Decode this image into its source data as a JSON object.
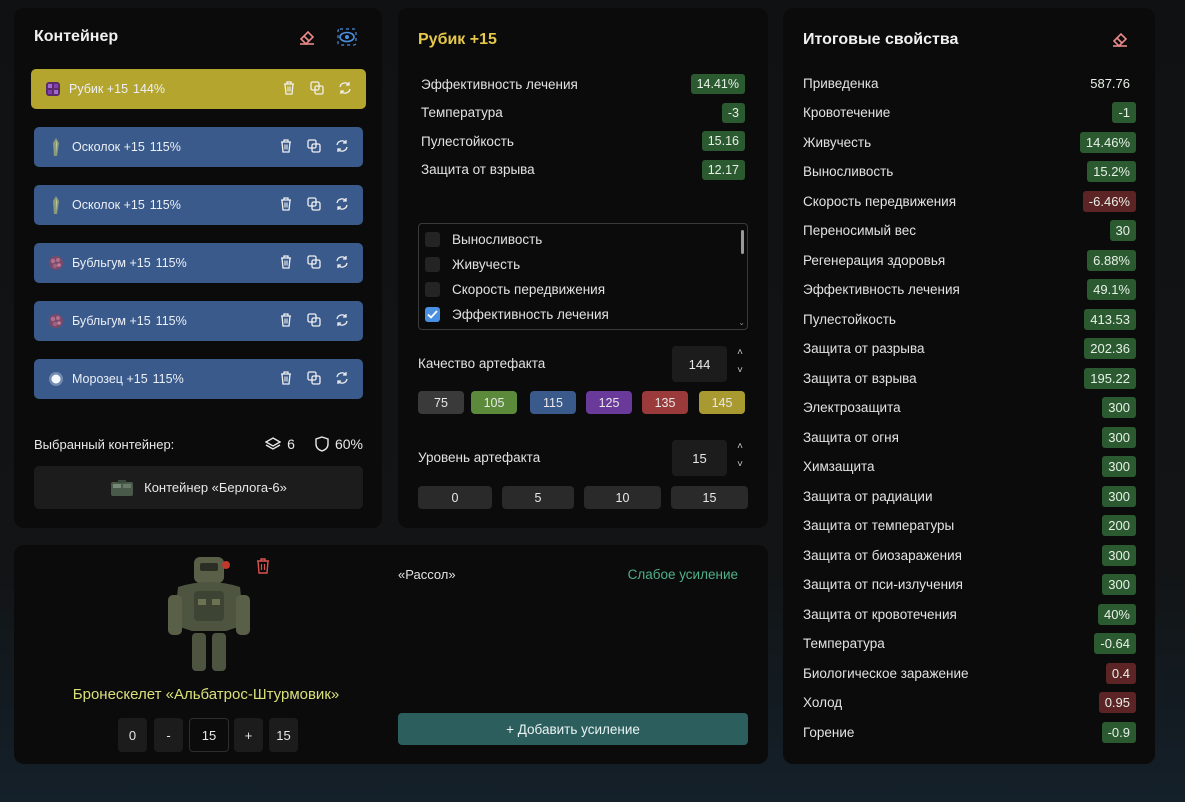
{
  "container": {
    "title": "Контейнер",
    "slots": [
      {
        "name": "Рубик +15",
        "pct": "144%",
        "active": true,
        "icon": "rubik-artifact-icon"
      },
      {
        "name": "Осколок +15",
        "pct": "115%",
        "active": false,
        "icon": "shard-artifact-icon"
      },
      {
        "name": "Осколок +15",
        "pct": "115%",
        "active": false,
        "icon": "shard-artifact-icon"
      },
      {
        "name": "Бубльгум +15",
        "pct": "115%",
        "active": false,
        "icon": "bubblegum-artifact-icon"
      },
      {
        "name": "Бубльгум +15",
        "pct": "115%",
        "active": false,
        "icon": "bubblegum-artifact-icon"
      },
      {
        "name": "Морозец +15",
        "pct": "115%",
        "active": false,
        "icon": "frost-artifact-icon"
      }
    ],
    "selected_label": "Выбранный контейнер:",
    "capacity": "6",
    "protection": "60%",
    "container_name": "Контейнер «Берлога-6»"
  },
  "artifact": {
    "title": "Рубик +15",
    "stats": [
      {
        "label": "Эффективность лечения",
        "value": "14.41%",
        "tone": "green"
      },
      {
        "label": "Температура",
        "value": "-3",
        "tone": "green"
      },
      {
        "label": "Пулестойкость",
        "value": "15.16",
        "tone": "green"
      },
      {
        "label": "Защита от взрыва",
        "value": "12.17",
        "tone": "green"
      }
    ],
    "options": [
      {
        "label": "Выносливость",
        "checked": false
      },
      {
        "label": "Живучесть",
        "checked": false
      },
      {
        "label": "Скорость передвижения",
        "checked": false
      },
      {
        "label": "Эффективность лечения",
        "checked": true
      }
    ],
    "quality_label": "Качество артефакта",
    "quality_value": "144",
    "quality_presets": [
      {
        "label": "75",
        "color": "#3a3a3a"
      },
      {
        "label": "105",
        "color": "#5a8a3a"
      },
      {
        "label": "115",
        "color": "#3a5a8c"
      },
      {
        "label": "125",
        "color": "#6a3a9a"
      },
      {
        "label": "135",
        "color": "#9a3a3a"
      },
      {
        "label": "145",
        "color": "#a89a30"
      }
    ],
    "level_label": "Уровень артефакта",
    "level_value": "15",
    "level_presets": [
      "0",
      "5",
      "10",
      "15"
    ]
  },
  "totals": {
    "title": "Итоговые свойства",
    "rows": [
      {
        "label": "Приведенка",
        "value": "587.76",
        "tone": "plain"
      },
      {
        "label": "Кровотечение",
        "value": "-1",
        "tone": "green"
      },
      {
        "label": "Живучесть",
        "value": "14.46%",
        "tone": "green"
      },
      {
        "label": "Выносливость",
        "value": "15.2%",
        "tone": "green"
      },
      {
        "label": "Скорость передвижения",
        "value": "-6.46%",
        "tone": "red"
      },
      {
        "label": "Переносимый вес",
        "value": "30",
        "tone": "green"
      },
      {
        "label": "Регенерация здоровья",
        "value": "6.88%",
        "tone": "green"
      },
      {
        "label": "Эффективность лечения",
        "value": "49.1%",
        "tone": "green"
      },
      {
        "label": "Пулестойкость",
        "value": "413.53",
        "tone": "green"
      },
      {
        "label": "Защита от разрыва",
        "value": "202.36",
        "tone": "green"
      },
      {
        "label": "Защита от взрыва",
        "value": "195.22",
        "tone": "green"
      },
      {
        "label": "Электрозащита",
        "value": "300",
        "tone": "green"
      },
      {
        "label": "Защита от огня",
        "value": "300",
        "tone": "green"
      },
      {
        "label": "Химзащита",
        "value": "300",
        "tone": "green"
      },
      {
        "label": "Защита от радиации",
        "value": "300",
        "tone": "green"
      },
      {
        "label": "Защита от температуры",
        "value": "200",
        "tone": "green"
      },
      {
        "label": "Защита от биозаражения",
        "value": "300",
        "tone": "green"
      },
      {
        "label": "Защита от пси-излучения",
        "value": "300",
        "tone": "green"
      },
      {
        "label": "Защита от кровотечения",
        "value": "40%",
        "tone": "green"
      },
      {
        "label": "Температура",
        "value": "-0.64",
        "tone": "green"
      },
      {
        "label": "Биологическое заражение",
        "value": "0.4",
        "tone": "red"
      },
      {
        "label": "Холод",
        "value": "0.95",
        "tone": "red"
      },
      {
        "label": "Горение",
        "value": "-0.9",
        "tone": "green"
      }
    ]
  },
  "armor": {
    "name": "Бронескелет «Альбатрос-Штурмовик»",
    "level_min": "0",
    "decrement": "-",
    "level_value": "15",
    "increment": "+",
    "level_max": "15",
    "boost_name": "«Рассол»",
    "boost_strength": "Слабое усиление",
    "add_boost": "+ Добавить усиление"
  },
  "colors": {
    "accent_yellow": "#e6c84a",
    "armor_name": "#d9e07a",
    "boost_green": "#4fb08a"
  }
}
